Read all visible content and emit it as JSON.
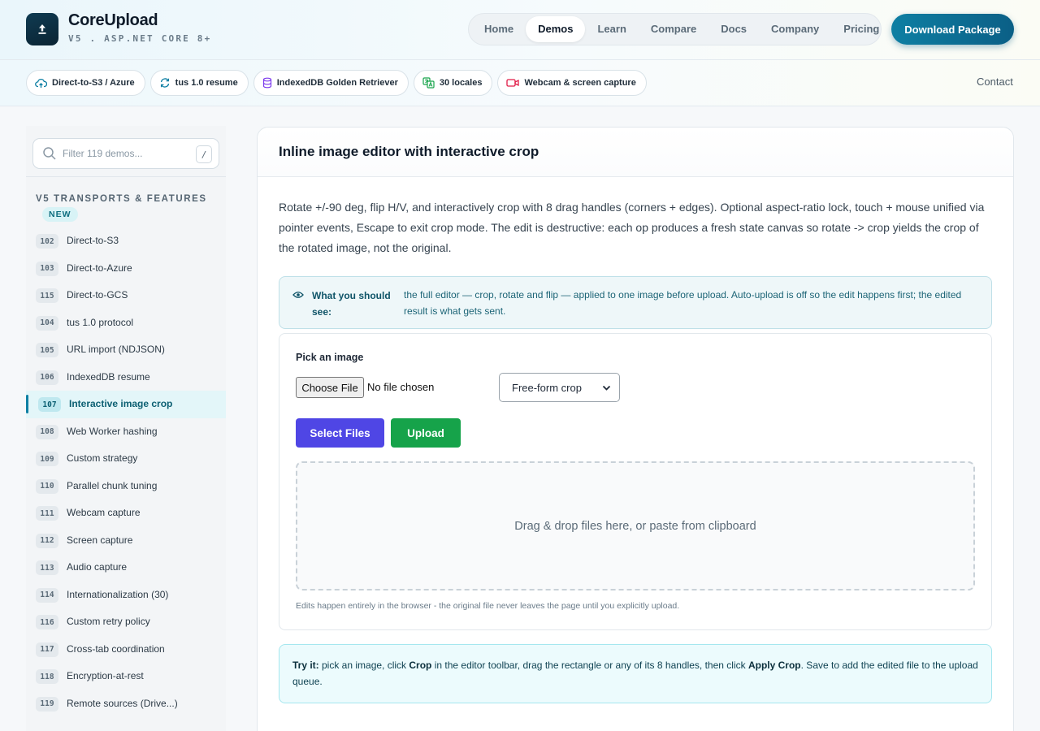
{
  "brand": {
    "name": "CoreUpload",
    "subtitle": "V5 . ASP.NET CORE 8+"
  },
  "nav": {
    "items": [
      {
        "label": "Home",
        "active": false
      },
      {
        "label": "Demos",
        "active": true
      },
      {
        "label": "Learn",
        "active": false
      },
      {
        "label": "Compare",
        "active": false
      },
      {
        "label": "Docs",
        "active": false
      },
      {
        "label": "Company",
        "active": false
      },
      {
        "label": "Pricing",
        "active": false
      }
    ],
    "download_label": "Download Package",
    "contact_label": "Contact"
  },
  "chips": [
    {
      "label": "Direct-to-S3 / Azure",
      "icon": "cloud-upload-icon",
      "color": "#0e7fa3"
    },
    {
      "label": "tus 1.0 resume",
      "icon": "refresh-icon",
      "color": "#0e7fa3"
    },
    {
      "label": "IndexedDB Golden Retriever",
      "icon": "database-icon",
      "color": "#7c3aed"
    },
    {
      "label": "30 locales",
      "icon": "translate-icon",
      "color": "#16a34a"
    },
    {
      "label": "Webcam & screen capture",
      "icon": "video-icon",
      "color": "#e11d48"
    }
  ],
  "sidebar": {
    "filter_placeholder": "Filter 119 demos...",
    "filter_shortcut": "/",
    "section_title": "V5 TRANSPORTS & FEATURES",
    "badge": "NEW",
    "items": [
      {
        "num": "102",
        "label": "Direct-to-S3",
        "active": false
      },
      {
        "num": "103",
        "label": "Direct-to-Azure",
        "active": false
      },
      {
        "num": "115",
        "label": "Direct-to-GCS",
        "active": false
      },
      {
        "num": "104",
        "label": "tus 1.0 protocol",
        "active": false
      },
      {
        "num": "105",
        "label": "URL import (NDJSON)",
        "active": false
      },
      {
        "num": "106",
        "label": "IndexedDB resume",
        "active": false
      },
      {
        "num": "107",
        "label": "Interactive image crop",
        "active": true
      },
      {
        "num": "108",
        "label": "Web Worker hashing",
        "active": false
      },
      {
        "num": "109",
        "label": "Custom strategy",
        "active": false
      },
      {
        "num": "110",
        "label": "Parallel chunk tuning",
        "active": false
      },
      {
        "num": "111",
        "label": "Webcam capture",
        "active": false
      },
      {
        "num": "112",
        "label": "Screen capture",
        "active": false
      },
      {
        "num": "113",
        "label": "Audio capture",
        "active": false
      },
      {
        "num": "114",
        "label": "Internationalization (30)",
        "active": false
      },
      {
        "num": "116",
        "label": "Custom retry policy",
        "active": false
      },
      {
        "num": "117",
        "label": "Cross-tab coordination",
        "active": false
      },
      {
        "num": "118",
        "label": "Encryption-at-rest",
        "active": false
      },
      {
        "num": "119",
        "label": "Remote sources (Drive...)",
        "active": false
      }
    ]
  },
  "main": {
    "title": "Inline image editor with interactive crop",
    "description": "Rotate +/-90 deg, flip H/V, and interactively crop with 8 drag handles (corners + edges). Optional aspect-ratio lock, touch + mouse unified via pointer events, Escape to exit crop mode. The edit is destructive: each op produces a fresh state canvas so rotate -> crop yields the crop of the rotated image, not the original.",
    "info_label": "What you should see:",
    "info_text": "the full editor — crop, rotate and flip — applied to one image before upload. Auto-upload is off so the edit happens first; the edited result is what gets sent.",
    "demo": {
      "pick_label": "Pick an image",
      "choose_file_label": "Choose File",
      "no_file_text": "No file chosen",
      "crop_mode_selected": "Free-form crop",
      "select_files_label": "Select Files",
      "upload_label": "Upload",
      "dropzone_text": "Drag & drop files here, or paste from clipboard",
      "edit_note": "Edits happen entirely in the browser - the original file never leaves the page until you explicitly upload."
    },
    "tryit": {
      "lead": "Try it:",
      "t1": " pick an image, click ",
      "b1": "Crop",
      "t2": " in the editor toolbar, drag the rectangle or any of its 8 handles, then click ",
      "b2": "Apply Crop",
      "t3": ". Save to add the edited file to the upload queue."
    }
  },
  "colors": {
    "accent": "#0e7fa3",
    "select_files": "#4f46e5",
    "upload": "#16a34a"
  }
}
